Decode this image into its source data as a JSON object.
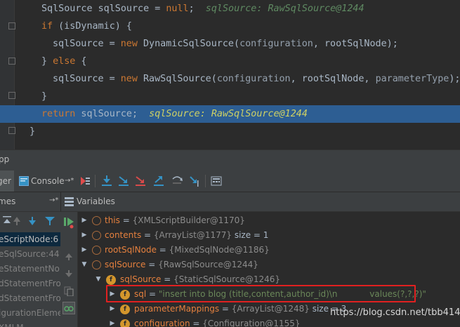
{
  "editor": {
    "lines": [
      {
        "indent": "",
        "parts": [
          [
            "",
            "SqlSource sqlSource = "
          ],
          [
            "kw",
            "null"
          ],
          [
            "",
            ";"
          ]
        ],
        "inline": "sqlSource: RawSqlSource@1244",
        "inline_style": "dim"
      },
      {
        "parts": [
          [
            "kw",
            "if"
          ],
          [
            "",
            " (isDynamic) {"
          ]
        ]
      },
      {
        "parts": [
          [
            "",
            "sqlSource = "
          ],
          [
            "kw",
            "new"
          ],
          [
            "",
            " DynamicSqlSource("
          ],
          [
            "prm",
            "configuration"
          ],
          [
            "",
            ", rootSqlNode);"
          ]
        ]
      },
      {
        "parts": [
          [
            "",
            "} "
          ],
          [
            "kw",
            "else"
          ],
          [
            "",
            " {"
          ]
        ]
      },
      {
        "parts": [
          [
            "",
            "sqlSource = "
          ],
          [
            "kw",
            "new"
          ],
          [
            "",
            " RawSqlSource("
          ],
          [
            "prm",
            "configuration"
          ],
          [
            "",
            ", rootSqlNode, "
          ],
          [
            "prm",
            "parameterType"
          ],
          [
            "",
            ");"
          ]
        ]
      },
      {
        "parts": [
          [
            "",
            "}"
          ]
        ]
      },
      {
        "parts": [
          [
            "kw",
            "return"
          ],
          [
            "",
            " sqlSource;"
          ]
        ],
        "inline": "sqlSource: RawSqlSource@1244",
        "inline_style": "bright"
      },
      {
        "parts": [
          [
            "",
            "}"
          ]
        ]
      }
    ]
  },
  "debug_title": "pp",
  "tabs": {
    "debugger_label": "ger",
    "console_label": "Console",
    "console_arrow": "→*"
  },
  "frames": {
    "header": "mes",
    "header_pin": "→*",
    "items": [
      {
        "text": "eScriptNode:6",
        "selected": true
      },
      {
        "text": "eSqlSource:44",
        "selected": false
      },
      {
        "text": "eStatementNo",
        "selected": false
      },
      {
        "text": "dStatementFro",
        "selected": false
      },
      {
        "text": "dStatementFro",
        "selected": false
      },
      {
        "text": "igurationEleme",
        "selected": false
      },
      {
        "text": "XMLM",
        "selected": false
      }
    ]
  },
  "variables": {
    "header": "Variables",
    "rows": [
      {
        "depth": 0,
        "expand": "right",
        "icon": "",
        "name": "this",
        "value": "{XMLScriptBuilder@1170}",
        "extra": ""
      },
      {
        "depth": 0,
        "expand": "right",
        "icon": "",
        "name": "contents",
        "value": "{ArrayList@1177}",
        "extra": "size = 1"
      },
      {
        "depth": 0,
        "expand": "right",
        "icon": "",
        "name": "rootSqlNode",
        "value": "{MixedSqlNode@1186}",
        "extra": ""
      },
      {
        "depth": 0,
        "expand": "down",
        "icon": "",
        "name": "sqlSource",
        "value": "{RawSqlSource@1244}",
        "extra": ""
      },
      {
        "depth": 1,
        "expand": "down",
        "icon": "f",
        "name": "sqlSource",
        "value": "{StaticSqlSource@1246}",
        "extra": ""
      },
      {
        "depth": 2,
        "expand": "right",
        "icon": "f",
        "name": "sql",
        "value": "\"insert into blog (title,content,author_id)\\n            values(?,?,?)\"",
        "extra": "",
        "string": true
      },
      {
        "depth": 2,
        "expand": "right",
        "icon": "f",
        "name": "parameterMappings",
        "value": "{ArrayList@1248}",
        "extra": "size = 3"
      },
      {
        "depth": 2,
        "expand": "right",
        "icon": "f",
        "name": "configuration",
        "value": "{Configuration@1155}",
        "extra": ""
      }
    ]
  },
  "watermark": "https://blog.csdn.net/tbb414",
  "colors": {
    "editor_bg": "#2b2b2b",
    "highlight": "#2d5e93",
    "keyword": "#cc7832",
    "inline_value": "#cfd164",
    "highlight_box": "#e02020"
  }
}
